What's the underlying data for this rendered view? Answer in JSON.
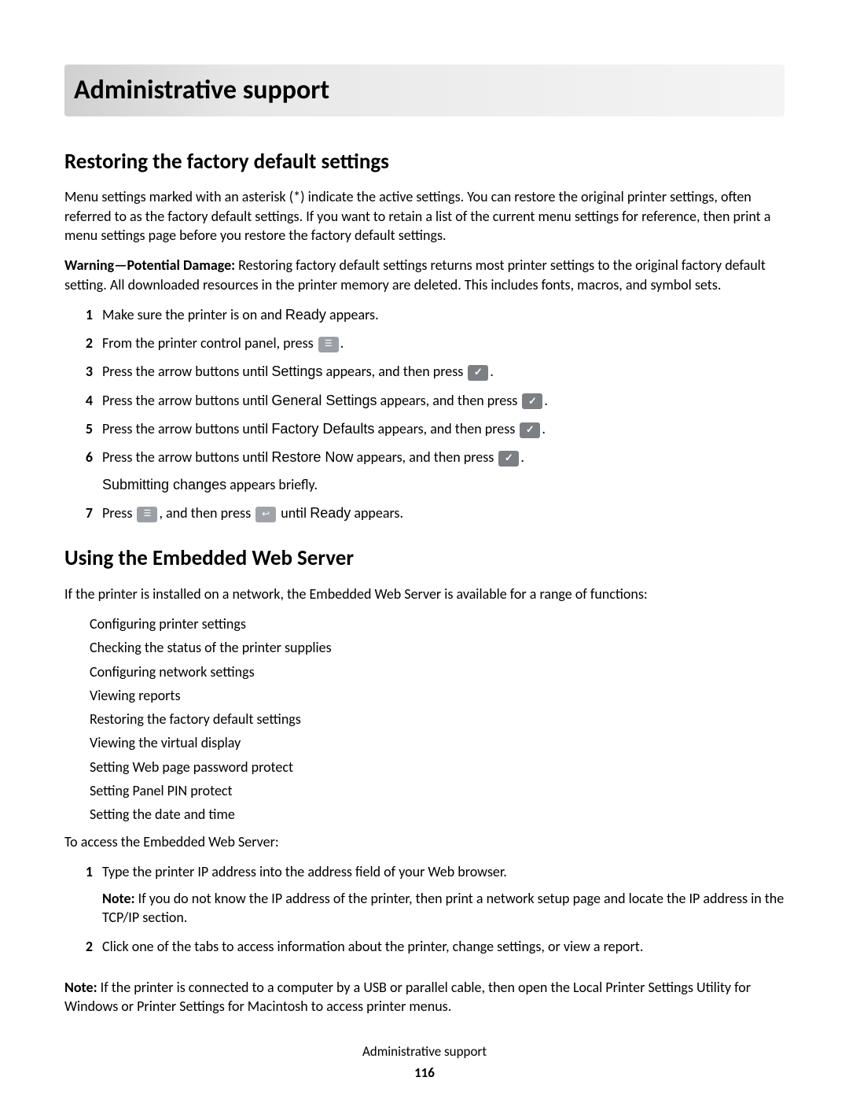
{
  "title": "Administrative support",
  "section1": {
    "heading": "Restoring the factory default settings",
    "intro_1": "Menu settings marked with an asterisk (*) indicate the active settings. You can restore the original printer settings, often referred to as the ",
    "intro_term": "factory default settings",
    "intro_2": ". If you want to retain a list of the current menu settings for reference, then print a menu settings page before you restore the factory default settings.",
    "warning_label": "Warning—Potential Damage:",
    "warning_body": " Restoring factory default settings returns most printer settings to the original factory default setting. All downloaded resources in the printer memory are deleted. This includes fonts, macros, and symbol sets.",
    "steps": [
      {
        "n": "1",
        "a": "Make sure the printer is on and ",
        "t": "Ready",
        "b": " appears."
      },
      {
        "n": "2",
        "a": "From the printer control panel, press ",
        "icon": "menu",
        "b": "."
      },
      {
        "n": "3",
        "a": "Press the arrow buttons until ",
        "t": "Settings",
        "mid": " appears, and then press ",
        "icon": "check",
        "b": "."
      },
      {
        "n": "4",
        "a": "Press the arrow buttons until ",
        "t": "General Settings",
        "mid": " appears, and then press ",
        "icon": "check",
        "b": "."
      },
      {
        "n": "5",
        "a": "Press the arrow buttons until ",
        "t": "Factory Defaults",
        "mid": " appears, and then press ",
        "icon": "check",
        "b": "."
      },
      {
        "n": "6",
        "a": "Press the arrow buttons until ",
        "t": "Restore Now",
        "mid": " appears, and then press ",
        "icon": "check",
        "b": ".",
        "sub_t": "Submitting changes",
        "sub_b": " appears briefly."
      },
      {
        "n": "7",
        "a": "Press ",
        "icon": "menu",
        "mid": ", and then press ",
        "icon2": "back",
        "post": " until ",
        "t": "Ready",
        "b": " appears."
      }
    ]
  },
  "section2": {
    "heading": "Using the Embedded Web Server",
    "intro": "If the printer is installed on a network, the Embedded Web Server is available for a range of functions:",
    "bullets": [
      "Configuring printer settings",
      "Checking the status of the printer supplies",
      "Configuring network settings",
      "Viewing reports",
      "Restoring the factory default settings",
      "Viewing the virtual display",
      "Setting Web page password protect",
      "Setting Panel PIN protect",
      "Setting the date and time"
    ],
    "access_line": "To access the Embedded Web Server:",
    "steps": [
      {
        "n": "1",
        "body": "Type the printer IP address into the address field of your Web browser.",
        "note_label": "Note:",
        "note_body": " If you do not know the IP address of the printer, then print a network setup page and locate the IP address in the TCP/IP section."
      },
      {
        "n": "2",
        "body": "Click one of the tabs to access information about the printer, change settings, or view a report."
      }
    ],
    "final_note_label": "Note:",
    "final_note_body": " If the printer is connected to a computer by a USB or parallel cable, then open the Local Printer Settings Utility for Windows or Printer Settings for Macintosh to access printer menus."
  },
  "footer": {
    "title": "Administrative support",
    "page": "116"
  }
}
